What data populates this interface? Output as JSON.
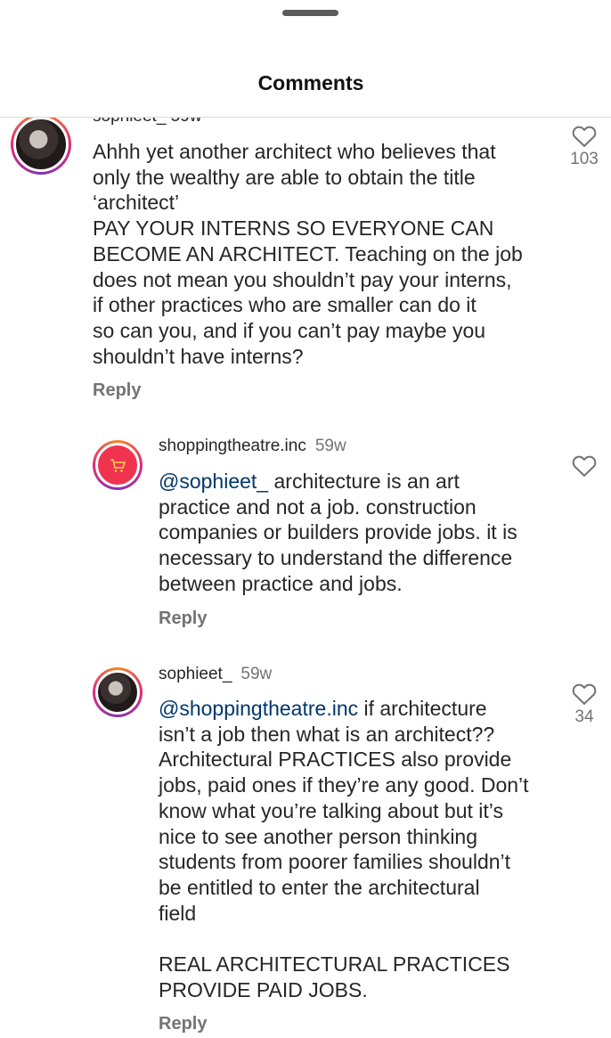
{
  "header": {
    "title": "Comments"
  },
  "comments": [
    {
      "partial_meta": "sophieet_ 59w",
      "text": "Ahhh yet another architect who believes that\nonly the wealthy are able to obtain the title\n‘architect’\nPAY YOUR INTERNS SO EVERYONE CAN\nBECOME AN ARCHITECT. Teaching on the job\ndoes not mean you shouldn’t pay your interns,\nif other practices who are smaller can do it\nso can you, and if you can’t pay maybe you\nshouldn’t have interns?",
      "reply_label": "Reply",
      "like_count": "103"
    },
    {
      "username": "shoppingtheatre.inc",
      "time": "59w",
      "mention": "@sophieet_",
      "text": " architecture is an art\npractice and not a job. construction\ncompanies or builders provide jobs. it is\nnecessary to understand the difference\nbetween practice and jobs.",
      "reply_label": "Reply"
    },
    {
      "username": "sophieet_",
      "time": "59w",
      "mention": "@shoppingtheatre.inc",
      "text": " if architecture\nisn’t a job then what is an architect??\nArchitectural PRACTICES also provide\njobs, paid ones if they’re any good. Don’t\nknow what you’re talking about but it’s\nnice to see another person thinking\nstudents from poorer families shouldn’t\nbe entitled to enter the architectural\nfield\n\nREAL ARCHITECTURAL PRACTICES\nPROVIDE PAID JOBS.",
      "reply_label": "Reply",
      "like_count": "34"
    }
  ],
  "icons": {
    "like": "heart-outline-icon"
  }
}
